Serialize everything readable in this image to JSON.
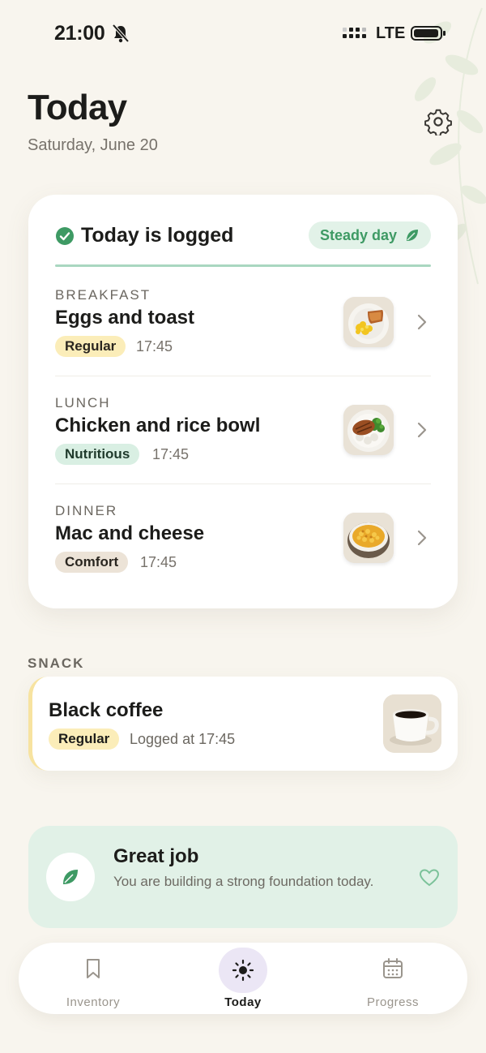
{
  "status_bar": {
    "time": "21:00",
    "network": "LTE"
  },
  "header": {
    "title": "Today",
    "date": "Saturday, June 20"
  },
  "summary_card": {
    "logged_text": "Today is logged",
    "badge": "Steady day",
    "meals": [
      {
        "category": "BREAKFAST",
        "name": "Eggs and toast",
        "tag": "Regular",
        "time": "17:45",
        "icon": "eggs-toast-plate"
      },
      {
        "category": "LUNCH",
        "name": "Chicken and rice bowl",
        "tag": "Nutritious",
        "time": "17:45",
        "icon": "chicken-rice-bowl"
      },
      {
        "category": "DINNER",
        "name": "Mac and cheese",
        "tag": "Comfort",
        "time": "17:45",
        "icon": "mac-cheese-bowl"
      }
    ]
  },
  "snack": {
    "heading": "SNACK",
    "name": "Black coffee",
    "tag": "Regular",
    "logged_at": "Logged at 17:45",
    "icon": "coffee-cup"
  },
  "encouragement": {
    "title": "Great job",
    "message": "You are building a strong foundation today."
  },
  "bottom_nav": {
    "items": [
      {
        "label": "Inventory",
        "icon": "bookmark-icon"
      },
      {
        "label": "Today",
        "icon": "sun-icon",
        "active": true
      },
      {
        "label": "Progress",
        "icon": "calendar-icon"
      }
    ]
  },
  "colors": {
    "accent_green": "#3e9a64",
    "background": "#f8f5ee",
    "regular_tag": "#fbedb9",
    "nutritious_tag": "#d9efe3",
    "comfort_tag": "#ece3d7"
  }
}
